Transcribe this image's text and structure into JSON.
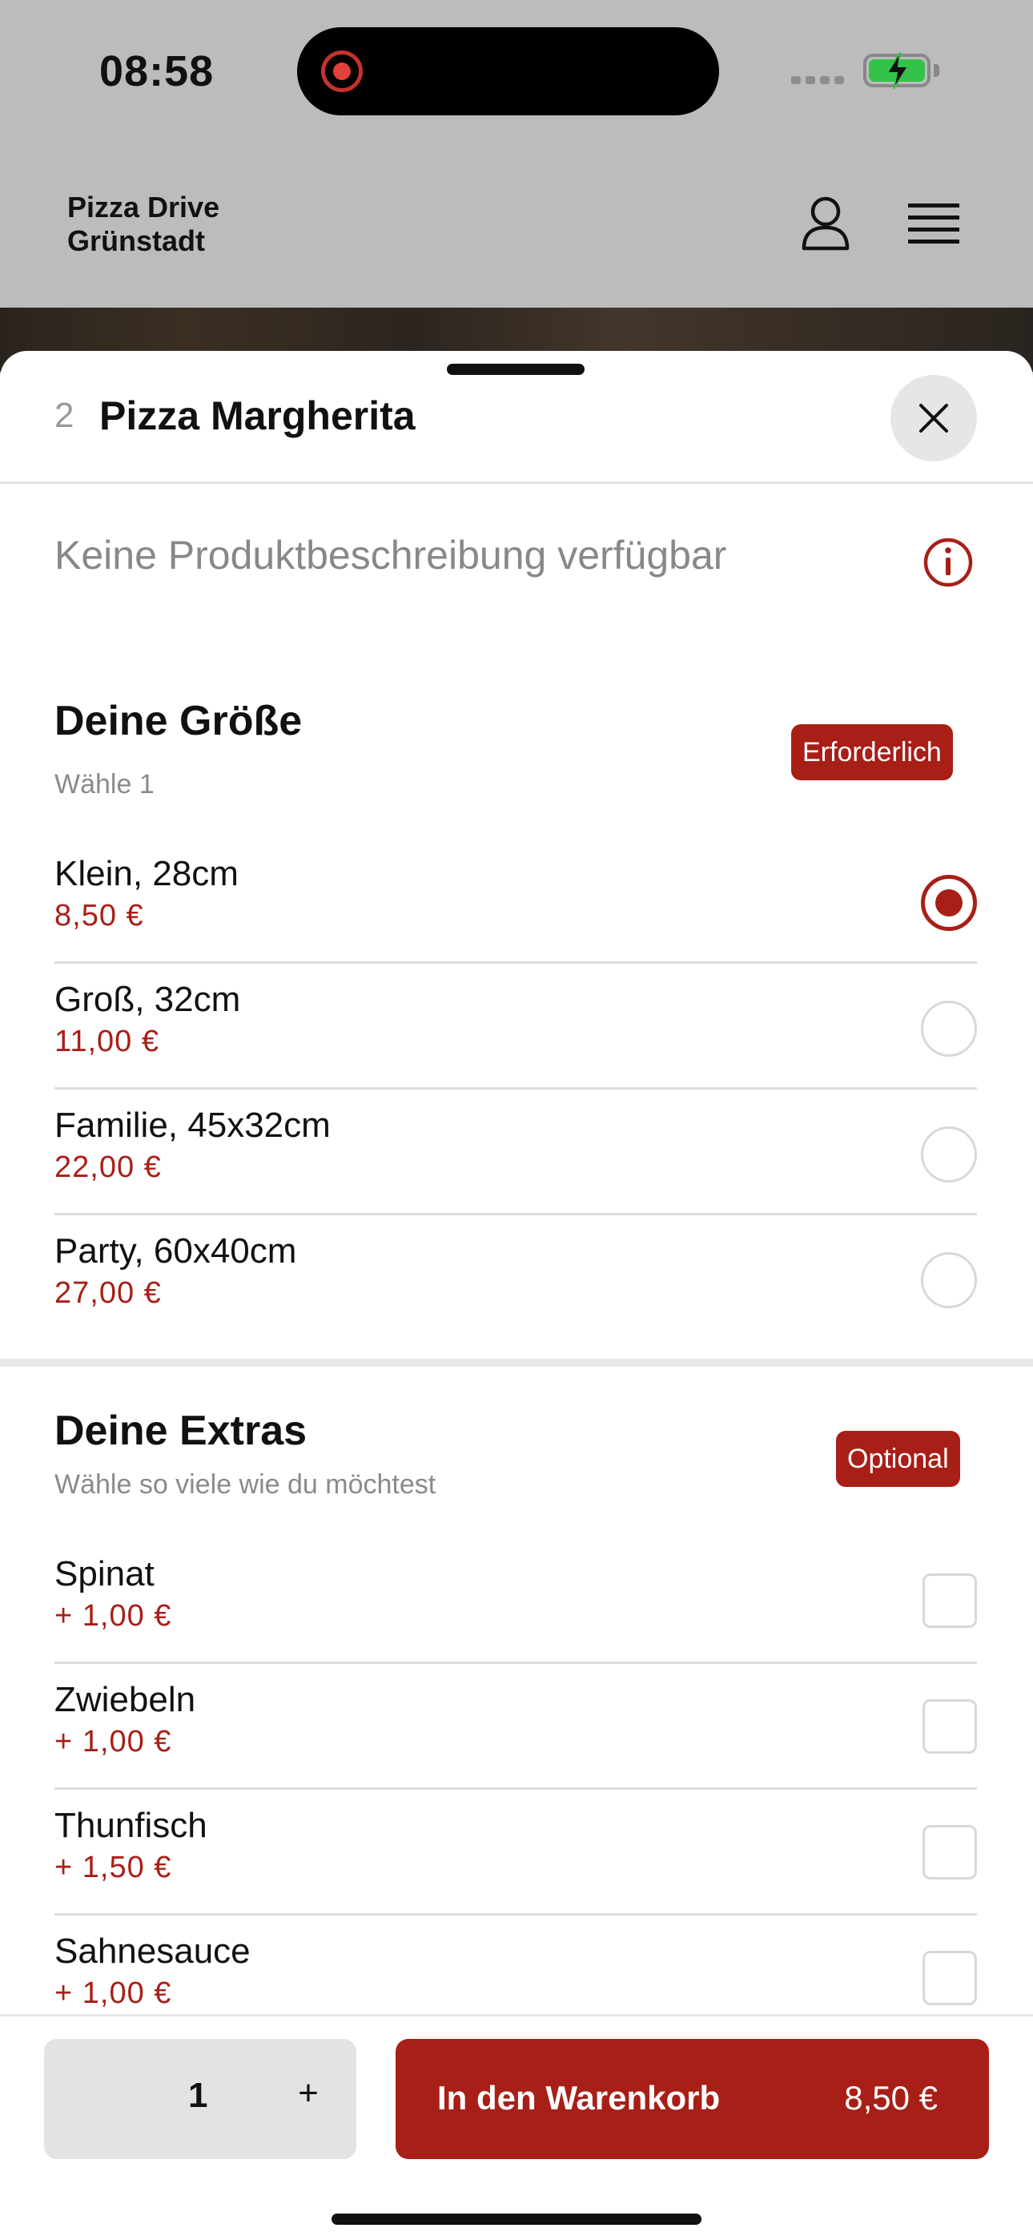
{
  "status_bar": {
    "time": "08:58"
  },
  "header": {
    "brand_line1": "Pizza Drive",
    "brand_line2": "Grünstadt",
    "icons": [
      "user-icon",
      "menu-icon"
    ]
  },
  "product": {
    "number": "2",
    "title": "Pizza Margherita",
    "description": "Keine Produktbeschreibung verfügbar"
  },
  "size_section": {
    "title": "Deine Größe",
    "subtitle": "Wähle 1",
    "badge": "Erforderlich",
    "options": [
      {
        "label": "Klein, 28cm",
        "price": "8,50 €",
        "selected": true
      },
      {
        "label": "Groß, 32cm",
        "price": "11,00 €",
        "selected": false
      },
      {
        "label": "Familie, 45x32cm",
        "price": "22,00 €",
        "selected": false
      },
      {
        "label": "Party, 60x40cm",
        "price": "27,00 €",
        "selected": false
      }
    ]
  },
  "extras_section": {
    "title": "Deine Extras",
    "subtitle": "Wähle so viele wie du möchtest",
    "badge": "Optional",
    "options": [
      {
        "label": "Spinat",
        "price": "+ 1,00 €",
        "checked": false
      },
      {
        "label": "Zwiebeln",
        "price": "+ 1,00 €",
        "checked": false
      },
      {
        "label": "Thunfisch",
        "price": "+ 1,50 €",
        "checked": false
      },
      {
        "label": "Sahnesauce",
        "price": "+ 1,00 €",
        "checked": false
      }
    ]
  },
  "footer": {
    "quantity": "1",
    "plus": "+",
    "add_label": "In den Warenkorb",
    "add_price": "8,50 €"
  },
  "colors": {
    "accent": "#a81f17",
    "header_bg": "#bcbcbc"
  }
}
